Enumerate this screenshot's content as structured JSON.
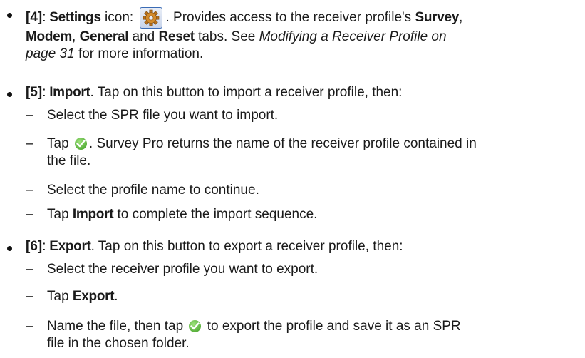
{
  "items": [
    {
      "ref": "[4]",
      "name": "Settings",
      "icon_word": " icon: ",
      "icon": "gear-icon",
      "desc_a": ". Provides access to the receiver profile's ",
      "tab1": "Survey",
      "sep1": ",",
      "tab2": "Modem",
      "sep2": ", ",
      "tab3": "General",
      "and": " and ",
      "tab4": "Reset",
      "desc_b": " tabs. See ",
      "xref1": "Modifying a Receiver Profile on",
      "xref2": "page 31",
      "desc_c": " for more information."
    },
    {
      "ref": "[5]",
      "name": "Import",
      "desc": ". Tap on this button to import a receiver profile, then:",
      "steps": [
        {
          "text": "Select the SPR file you want to import."
        },
        {
          "pre": "Tap ",
          "icon": "check-icon",
          "post": ". Survey Pro returns the name of the receiver profile contained in",
          "post2": "the file."
        },
        {
          "text": "Select the profile name to continue."
        },
        {
          "pre": "Tap ",
          "bold": "Import",
          "post": " to complete the import sequence."
        }
      ]
    },
    {
      "ref": "[6]",
      "name": "Export",
      "desc": ". Tap on this button to export a receiver profile, then:",
      "steps": [
        {
          "text": "Select the receiver profile you want to export."
        },
        {
          "pre": "Tap ",
          "bold": "Export",
          "post": "."
        },
        {
          "pre": "Name the file, then tap ",
          "icon": "check-icon",
          "post": " to export the profile and save it as an SPR",
          "post2": "file in the chosen folder."
        }
      ]
    }
  ],
  "colon": ": ",
  "dash": "–",
  "colors": {
    "gear_border": "#3a6bb5",
    "check_green": "#3a9a1f",
    "text": "#1a1a1a"
  }
}
